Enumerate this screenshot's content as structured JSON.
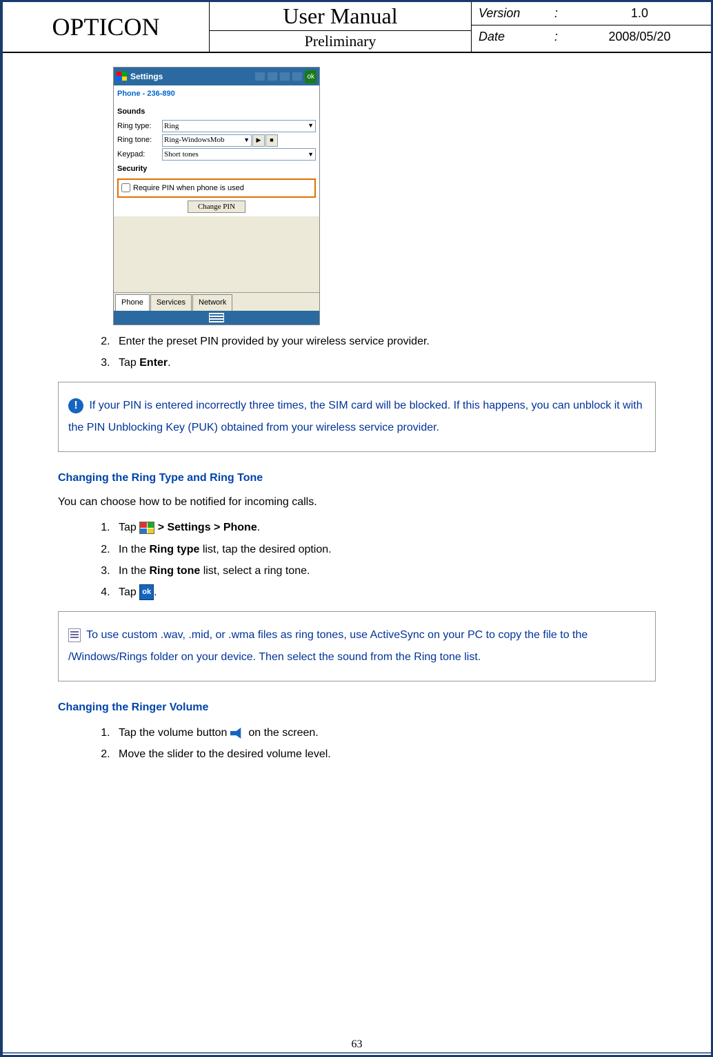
{
  "header": {
    "brand": "OPTICON",
    "title": "User Manual",
    "subtitle": "Preliminary",
    "version_label": "Version",
    "version_value": "1.0",
    "date_label": "Date",
    "date_value": "2008/05/20"
  },
  "screenshot": {
    "title": "Settings",
    "phone_line": "Phone - 236-890",
    "sounds_heading": "Sounds",
    "ring_type_label": "Ring type:",
    "ring_type_value": "Ring",
    "ring_tone_label": "Ring tone:",
    "ring_tone_value": "Ring-WindowsMob",
    "keypad_label": "Keypad:",
    "keypad_value": "Short tones",
    "security_heading": "Security",
    "require_pin": "Require PIN when phone is used",
    "change_pin": "Change PIN",
    "tabs": [
      "Phone",
      "Services",
      "Network"
    ],
    "titlebar_ok": "ok"
  },
  "steps_pin": {
    "s2": "Enter the preset PIN provided by your wireless service provider.",
    "s3_pre": "Tap ",
    "s3_bold": "Enter",
    "s3_post": "."
  },
  "warn_note": "If your PIN is entered incorrectly three times, the SIM card will be blocked. If this happens, you can unblock it with the PIN Unblocking Key (PUK) obtained from your wireless service provider.",
  "ring_section": {
    "heading": "Changing the Ring Type and Ring Tone",
    "intro": "You can choose how to be notified for incoming calls.",
    "s1_pre": "Tap ",
    "s1_bold": " > Settings > Phone",
    "s1_post": ".",
    "s2_pre": "In the ",
    "s2_bold": "Ring type",
    "s2_post": " list, tap the desired option.",
    "s3_pre": "In the ",
    "s3_bold": "Ring tone",
    "s3_post": " list, select a ring tone.",
    "s4_pre": "Tap ",
    "s4_post": "."
  },
  "doc_note": "To use custom .wav, .mid, or .wma files as ring tones, use ActiveSync on your PC to copy the file to the /Windows/Rings folder on your device. Then select the sound from the Ring tone list.",
  "vol_section": {
    "heading": "Changing the Ringer Volume",
    "s1_pre": "Tap the volume button ",
    "s1_post": " on the screen.",
    "s2": "Move the slider to the desired volume level."
  },
  "inline_ok_text": "ok",
  "page_number": "63"
}
